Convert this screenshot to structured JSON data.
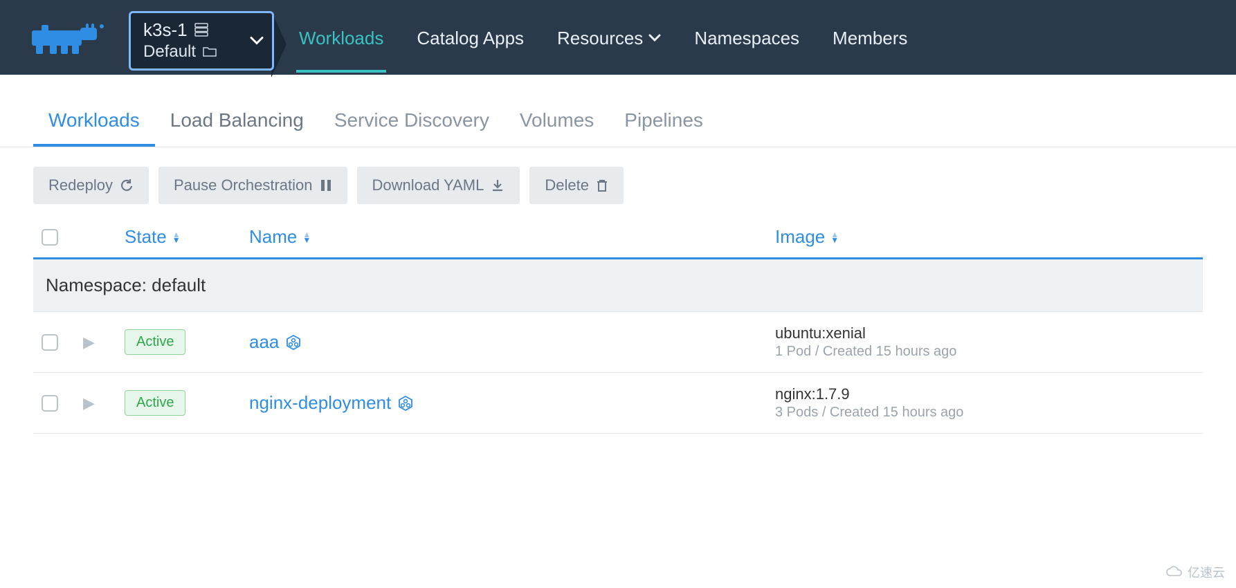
{
  "header": {
    "cluster": "k3s-1",
    "project": "Default",
    "nav": [
      {
        "label": "Workloads",
        "has_caret": false,
        "active": true
      },
      {
        "label": "Catalog Apps",
        "has_caret": false,
        "active": false
      },
      {
        "label": "Resources",
        "has_caret": true,
        "active": false
      },
      {
        "label": "Namespaces",
        "has_caret": false,
        "active": false
      },
      {
        "label": "Members",
        "has_caret": false,
        "active": false
      }
    ]
  },
  "subtabs": [
    {
      "label": "Workloads",
      "active": true
    },
    {
      "label": "Load Balancing",
      "active": false
    },
    {
      "label": "Service Discovery",
      "active": false
    },
    {
      "label": "Volumes",
      "active": false
    },
    {
      "label": "Pipelines",
      "active": false
    }
  ],
  "toolbar": {
    "redeploy": "Redeploy",
    "pause": "Pause Orchestration",
    "download": "Download YAML",
    "delete": "Delete"
  },
  "columns": {
    "state": "State",
    "name": "Name",
    "image": "Image"
  },
  "namespace_label": "Namespace: default",
  "rows": [
    {
      "state": "Active",
      "name": "aaa",
      "image": "ubuntu:xenial",
      "meta": "1 Pod / Created 15 hours ago"
    },
    {
      "state": "Active",
      "name": "nginx-deployment",
      "image": "nginx:1.7.9",
      "meta": "3 Pods / Created 15 hours ago"
    }
  ],
  "watermark": "亿速云"
}
